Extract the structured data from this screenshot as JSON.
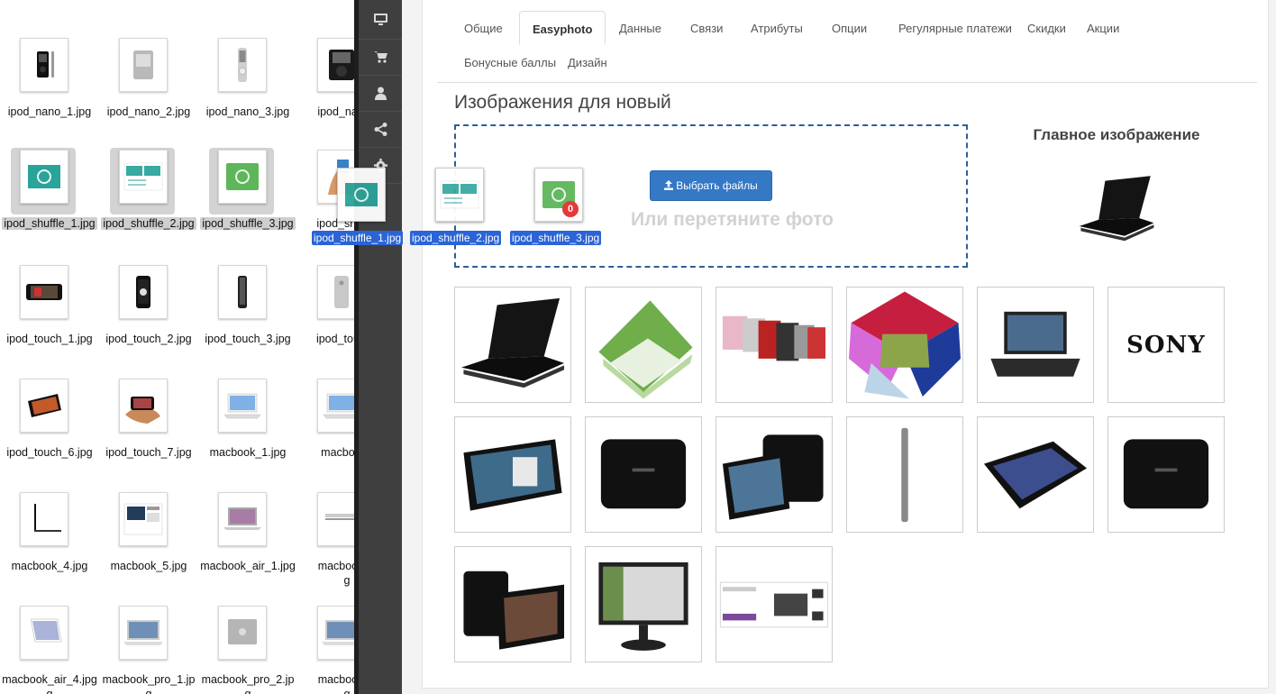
{
  "finder": {
    "files": [
      {
        "name": "ipod_nano_1.jpg",
        "kind": "nano-black"
      },
      {
        "name": "ipod_nano_2.jpg",
        "kind": "nano-silver"
      },
      {
        "name": "ipod_nano_3.jpg",
        "kind": "nano-tall"
      },
      {
        "name": "ipod_nano_",
        "kind": "nano-classic"
      },
      {
        "name": "ipod_shuffle_1.jpg",
        "kind": "shuffle-teal",
        "selected": true
      },
      {
        "name": "ipod_shuffle_2.jpg",
        "kind": "shuffle-sheet",
        "selected": true
      },
      {
        "name": "ipod_shuffle_3.jpg",
        "kind": "shuffle-green",
        "selected": true
      },
      {
        "name": "ipod_shuffle",
        "kind": "shuffle-hand"
      },
      {
        "name": "ipod_touch_1.jpg",
        "kind": "touch-wide"
      },
      {
        "name": "ipod_touch_2.jpg",
        "kind": "touch-tall"
      },
      {
        "name": "ipod_touch_3.jpg",
        "kind": "touch-side"
      },
      {
        "name": "ipod_touch_",
        "kind": "touch-silver"
      },
      {
        "name": "ipod_touch_6.jpg",
        "kind": "touch-angled"
      },
      {
        "name": "ipod_touch_7.jpg",
        "kind": "touch-hand"
      },
      {
        "name": "macbook_1.jpg",
        "kind": "mac-white"
      },
      {
        "name": "macbook_",
        "kind": "mac-white"
      },
      {
        "name": "macbook_4.jpg",
        "kind": "mac-side"
      },
      {
        "name": "macbook_5.jpg",
        "kind": "mac-page"
      },
      {
        "name": "macbook_air_1.jpg",
        "kind": "mac-air"
      },
      {
        "name": "macbook_a",
        "kind": "mac-flat",
        "name2": "g"
      },
      {
        "name": "macbook_air_4.jpg",
        "kind": "mac-thin",
        "name2": "g"
      },
      {
        "name": "macbook_pro_1.jp",
        "kind": "mac-pro",
        "name2": "g"
      },
      {
        "name": "macbook_pro_2.jp",
        "kind": "mac-lid",
        "name2": "g"
      },
      {
        "name": "macbook_p",
        "kind": "mac-pro",
        "name2": "g"
      }
    ]
  },
  "sidebar": {
    "items": [
      {
        "icon": "monitor-icon"
      },
      {
        "icon": "cart-icon"
      },
      {
        "icon": "user-icon"
      },
      {
        "icon": "share-icon"
      },
      {
        "icon": "gear-icon"
      }
    ]
  },
  "tabs": [
    {
      "label": "Общие"
    },
    {
      "label": "Easyphoto",
      "active": true
    },
    {
      "label": "Данные"
    },
    {
      "label": "Связи"
    },
    {
      "label": "Атрибуты"
    },
    {
      "label": "Опции"
    },
    {
      "label": "Регулярные платежи"
    },
    {
      "label": "Скидки"
    },
    {
      "label": "Акции"
    },
    {
      "label": "Бонусные баллы"
    },
    {
      "label": "Дизайн"
    }
  ],
  "uploader": {
    "heading": "Изображения для новый",
    "button_label": "Выбрать файлы",
    "hint": "Или перетяните фото",
    "badge_count": "0"
  },
  "main_image": {
    "title": "Главное изображение",
    "kind": "laptop-black"
  },
  "drag": {
    "labels": [
      "ipod_shuffle_1.jpg",
      "ipod_shuffle_2.jpg",
      "ipod_shuffle_3.jpg"
    ]
  },
  "gallery": {
    "images": [
      {
        "kind": "laptop-black"
      },
      {
        "kind": "laptop-green"
      },
      {
        "kind": "laptop-row"
      },
      {
        "kind": "laptop-flower"
      },
      {
        "kind": "laptop-open"
      },
      {
        "kind": "sony-logo",
        "text": "SONY"
      },
      {
        "kind": "tablet-a"
      },
      {
        "kind": "tablet-back"
      },
      {
        "kind": "tablet-pair"
      },
      {
        "kind": "tablet-edge"
      },
      {
        "kind": "tablet-flat"
      },
      {
        "kind": "tablet-back"
      },
      {
        "kind": "tablet-group"
      },
      {
        "kind": "monitor"
      },
      {
        "kind": "web-page"
      }
    ]
  },
  "colors": {
    "accent": "#3478c6",
    "dropzone_border": "#2d5f94",
    "drag_label_bg": "#2a64d6",
    "badge": "#e23030",
    "sidebar_bg": "#3f3f3f"
  }
}
